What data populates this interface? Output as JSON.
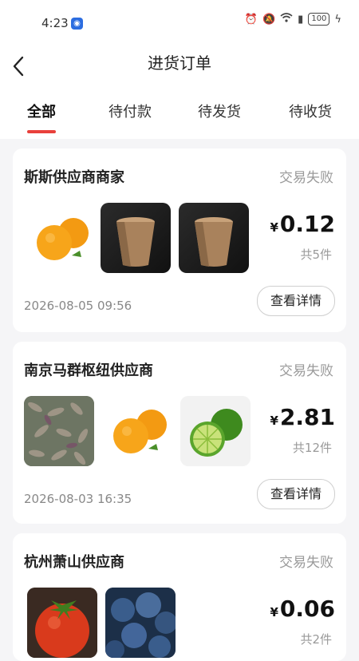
{
  "status": {
    "time": "4:23",
    "battery": "100"
  },
  "header": {
    "title": "进货订单"
  },
  "tabs": [
    {
      "label": "全部",
      "active": true
    },
    {
      "label": "待付款"
    },
    {
      "label": "待发货"
    },
    {
      "label": "待收货"
    }
  ],
  "orders": [
    {
      "shop": "斯斯供应商商家",
      "status": "交易失败",
      "currency": "¥",
      "price": "0.12",
      "count": "共5件",
      "date": "2026-08-05 09:56",
      "button": "查看详情",
      "items": [
        "oranges",
        "paper-cup",
        "paper-cup"
      ]
    },
    {
      "shop": "南京马群枢纽供应商",
      "status": "交易失败",
      "currency": "¥",
      "price": "2.81",
      "count": "共12件",
      "date": "2026-08-03 16:35",
      "button": "查看详情",
      "items": [
        "dried-pods",
        "oranges",
        "limes"
      ]
    },
    {
      "shop": "杭州萧山供应商",
      "status": "交易失败",
      "currency": "¥",
      "price": "0.06",
      "count": "共2件",
      "items": [
        "tomato",
        "blueberries"
      ]
    }
  ],
  "colors": {
    "accent": "#e8403b",
    "status_text": "#9a9a9a"
  }
}
